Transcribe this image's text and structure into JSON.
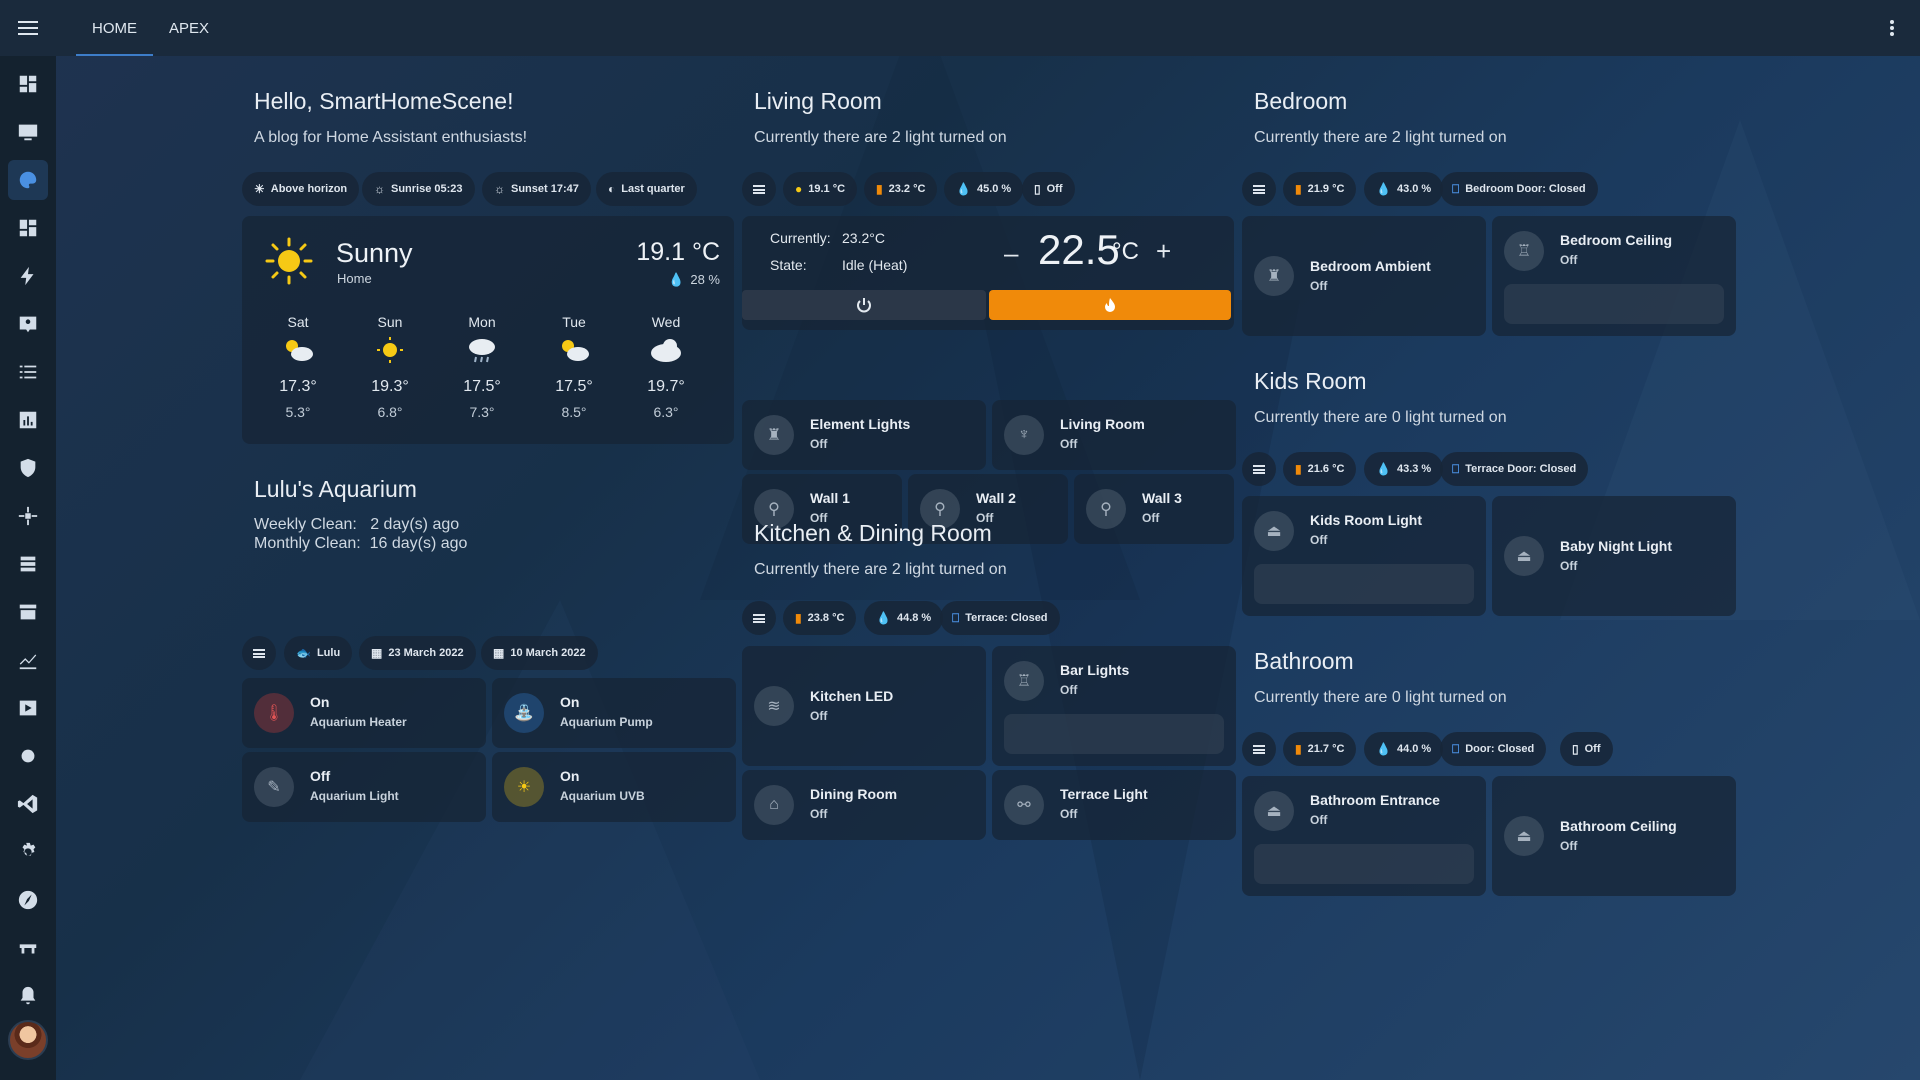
{
  "topbar": {
    "tabs": [
      "HOME",
      "APEX"
    ]
  },
  "sidebar": {
    "icons": [
      "dashboard-icon",
      "monitor-icon",
      "palette-icon",
      "dashboard-icon",
      "energy-icon",
      "person-card-icon",
      "list-icon",
      "chart-icon",
      "shield-icon",
      "network-icon",
      "hacs-list-icon",
      "hacs-store-icon",
      "trend-icon",
      "media-icon",
      "gear-code-icon",
      "vscode-icon",
      "settings-icon",
      "compass-icon",
      "tools-icon",
      "bell-icon"
    ]
  },
  "welcome": {
    "title": "Hello, SmartHomeScene!",
    "subtitle": "A blog for Home Assistant enthusiasts!",
    "chips": [
      "Above horizon",
      "Sunrise 05:23",
      "Sunset 17:47",
      "Last quarter"
    ]
  },
  "weather": {
    "condition": "Sunny",
    "location": "Home",
    "temperature": "19.1 °C",
    "humidity": "28 %",
    "forecast": [
      {
        "day": "Sat",
        "hi": "17.3°",
        "lo": "5.3°",
        "icon": "partly-cloudy-icon"
      },
      {
        "day": "Sun",
        "hi": "19.3°",
        "lo": "6.8°",
        "icon": "sun-icon"
      },
      {
        "day": "Mon",
        "hi": "17.5°",
        "lo": "7.3°",
        "icon": "rain-icon"
      },
      {
        "day": "Tue",
        "hi": "17.5°",
        "lo": "8.5°",
        "icon": "partly-cloudy-icon"
      },
      {
        "day": "Wed",
        "hi": "19.7°",
        "lo": "6.3°",
        "icon": "cloud-icon"
      }
    ]
  },
  "aquarium": {
    "title": "Lulu's Aquarium",
    "weekly": "Weekly Clean:   2 day(s) ago",
    "monthly": "Monthly Clean:  16 day(s) ago",
    "chips": [
      "Lulu",
      "23 March 2022",
      "10 March 2022"
    ],
    "devices": [
      {
        "state": "On",
        "name": "Aquarium Heater"
      },
      {
        "state": "On",
        "name": "Aquarium Pump"
      },
      {
        "state": "Off",
        "name": "Aquarium Light"
      },
      {
        "state": "On",
        "name": "Aquarium UVB"
      }
    ]
  },
  "living": {
    "title": "Living Room",
    "subtitle": "Currently there are 2 light turned on",
    "chips": [
      "19.1 °C",
      "23.2 °C",
      "45.0 %",
      "Off"
    ],
    "thermostat": {
      "current_label": "Currently:",
      "current_value": "23.2°C",
      "state_label": "State:",
      "state_value": "Idle (Heat)",
      "target": "22.5",
      "unit": "°C",
      "minus": "–",
      "plus": "+"
    },
    "lights": [
      {
        "name": "Element Lights",
        "state": "Off"
      },
      {
        "name": "Living Room",
        "state": "Off"
      },
      {
        "name": "Wall 1",
        "state": "Off"
      },
      {
        "name": "Wall 2",
        "state": "Off"
      },
      {
        "name": "Wall 3",
        "state": "Off"
      }
    ]
  },
  "kitchen": {
    "title": "Kitchen & Dining Room",
    "subtitle": "Currently there are 2 light turned on",
    "chips": [
      "23.8 °C",
      "44.8 %",
      "Terrace: Closed"
    ],
    "lights": [
      {
        "name": "Kitchen LED",
        "state": "Off"
      },
      {
        "name": "Bar Lights",
        "state": "Off"
      },
      {
        "name": "Dining Room",
        "state": "Off"
      },
      {
        "name": "Terrace Light",
        "state": "Off"
      }
    ]
  },
  "bedroom": {
    "title": "Bedroom",
    "subtitle": "Currently there are 2 light turned on",
    "chips": [
      "21.9 °C",
      "43.0 %",
      "Bedroom Door: Closed"
    ],
    "lights": [
      {
        "name": "Bedroom Ambient",
        "state": "Off"
      },
      {
        "name": "Bedroom Ceiling",
        "state": "Off"
      }
    ]
  },
  "kids": {
    "title": "Kids Room",
    "subtitle": "Currently there are 0 light turned on",
    "chips": [
      "21.6 °C",
      "43.3 %",
      "Terrace Door: Closed"
    ],
    "lights": [
      {
        "name": "Kids Room Light",
        "state": "Off"
      },
      {
        "name": "Baby Night Light",
        "state": "Off"
      }
    ]
  },
  "bathroom": {
    "title": "Bathroom",
    "subtitle": "Currently there are 0 light turned on",
    "chips": [
      "21.7 °C",
      "44.0 %",
      "Door: Closed",
      "Off"
    ],
    "lights": [
      {
        "name": "Bathroom Entrance",
        "state": "Off"
      },
      {
        "name": "Bathroom Ceiling",
        "state": "Off"
      }
    ]
  },
  "colors": {
    "accent": "#3d7dc9",
    "heat": "#f08a0a",
    "sun": "#f6c915",
    "heater": "#c23c3c",
    "pump": "#2f78c8"
  }
}
